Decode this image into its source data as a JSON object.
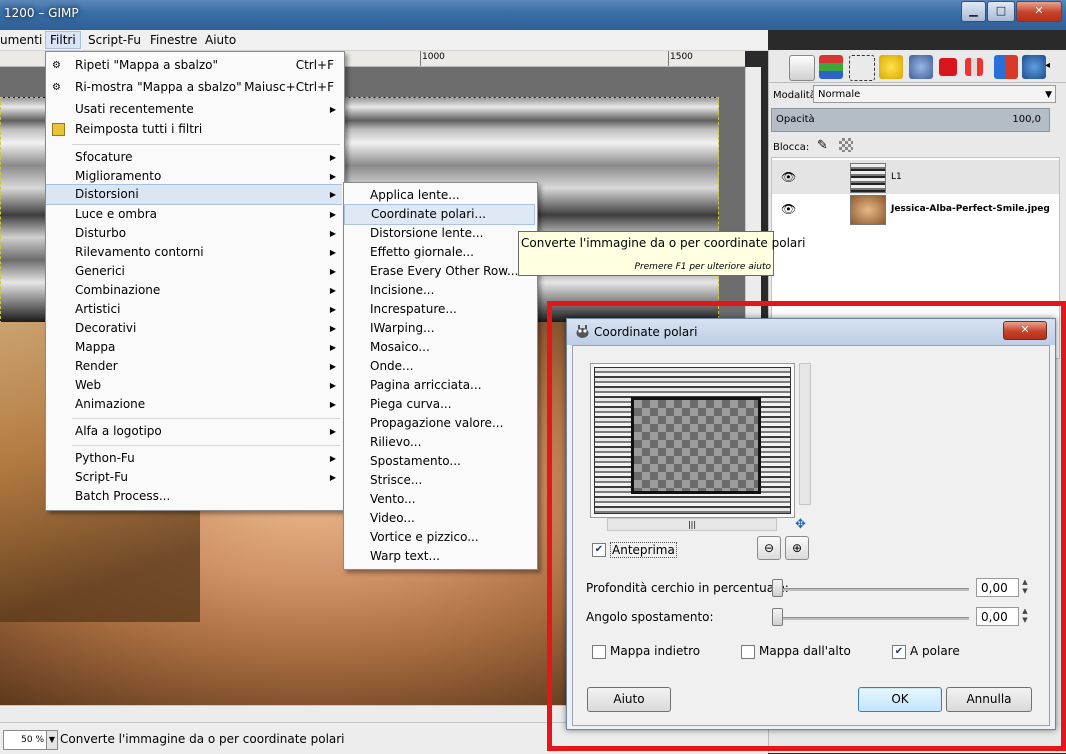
{
  "window": {
    "title": "1200 – GIMP"
  },
  "menubar": {
    "items": [
      "umenti",
      "Filtri",
      "Script-Fu",
      "Finestre",
      "Aiuto"
    ]
  },
  "ruler": {
    "labels": [
      "1000",
      "1500"
    ]
  },
  "statusbar": {
    "zoom": "50 %",
    "message": "Converte l'immagine da o per coordinate polari"
  },
  "dock": {
    "mode_label": "Modalità:",
    "mode_value": "Normale",
    "opacity_label": "Opacità",
    "opacity_value": "100,0",
    "lock_label": "Blocca:",
    "layers": [
      {
        "name": "L1"
      },
      {
        "name": "Jessica-Alba-Perfect-Smile.jpeg"
      }
    ]
  },
  "filters_menu": {
    "repeat": {
      "label": "Ripeti \"Mappa a sbalzo\"",
      "shortcut": "Ctrl+F"
    },
    "reshow": {
      "label": "Ri-mostra \"Mappa a sbalzo\"",
      "shortcut": "Maiusc+Ctrl+F"
    },
    "recent": "Usati recentemente",
    "reset": "Reimposta tutti i filtri",
    "categories": [
      "Sfocature",
      "Miglioramento",
      "Distorsioni",
      "Luce e ombra",
      "Disturbo",
      "Rilevamento contorni",
      "Generici",
      "Combinazione",
      "Artistici",
      "Decorativi",
      "Mappa",
      "Render",
      "Web",
      "Animazione"
    ],
    "logo": "Alfa a logotipo",
    "scripts": [
      "Python-Fu",
      "Script-Fu",
      "Batch Process..."
    ]
  },
  "distort_menu": {
    "items": [
      "Applica lente...",
      "Coordinate polari...",
      "Distorsione lente...",
      "Effetto giornale...",
      "Erase Every Other Row...",
      "Incisione...",
      "Increspature...",
      "IWarping...",
      "Mosaico...",
      "Onde...",
      "Pagina arricciata...",
      "Piega curva...",
      "Propagazione valore...",
      "Rilievo...",
      "Spostamento...",
      "Strisce...",
      "Vento...",
      "Video...",
      "Vortice e pizzico...",
      "Warp text..."
    ]
  },
  "tooltip": {
    "main": "Converte l'immagine da o per coordinate polari",
    "hint": "Premere F1 per ulteriore aiuto"
  },
  "dialog": {
    "title": "Coordinate polari",
    "preview_label": "Anteprima",
    "depth_label": "Profondità cerchio in percentuale:",
    "depth_value": "0,00",
    "angle_label": "Angolo spostamento:",
    "angle_value": "0,00",
    "map_backwards": "Mappa indietro",
    "map_from_top": "Mappa dall'alto",
    "to_polar": "A polare",
    "help": "Aiuto",
    "ok": "OK",
    "cancel": "Annulla"
  },
  "colors": {
    "highlight_frame": "#e4161a",
    "menu_highlight": "#dbe6f4",
    "titlebar": "#3a6fa8"
  }
}
